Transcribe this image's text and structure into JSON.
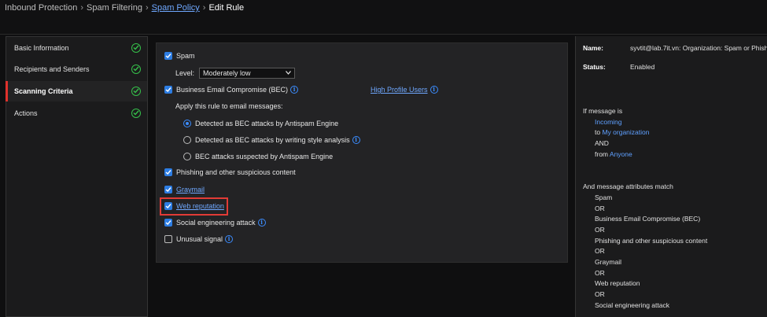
{
  "breadcrumb": {
    "items": [
      "Inbound Protection",
      "Spam Filtering",
      "Spam Policy",
      "Edit Rule"
    ],
    "sep": "›"
  },
  "leftnav": {
    "items": [
      {
        "label": "Basic Information"
      },
      {
        "label": "Recipients and Senders"
      },
      {
        "label": "Scanning Criteria"
      },
      {
        "label": "Actions"
      }
    ]
  },
  "main": {
    "spam_label": "Spam",
    "level_label": "Level:",
    "level_value": "Moderately low",
    "bec_label": "Business Email Compromise (BEC)",
    "high_profile_link": "High Profile Users",
    "apply_label": "Apply this rule to email messages:",
    "radio_antispam": "Detected as BEC attacks by Antispam Engine",
    "radio_writing": "Detected as BEC attacks by writing style analysis",
    "radio_suspected": "BEC attacks suspected by Antispam Engine",
    "phishing_label": "Phishing and other suspicious content",
    "graymail_label": "Graymail",
    "web_rep_label": "Web reputation",
    "social_label": "Social engineering attack",
    "unusual_label": "Unusual signal",
    "info_glyph": "i"
  },
  "summary": {
    "name_label": "Name:",
    "name_value": "syvtit@lab.7it.vn: Organization: Spam or Phish",
    "status_label": "Status:",
    "status_value": "Enabled",
    "if_message": "If message is",
    "incoming": "Incoming",
    "to": "to",
    "my_org": "My organization",
    "and": "AND",
    "from": "from",
    "anyone": "Anyone",
    "attr_match": "And message attributes match",
    "attrs": [
      "Spam",
      "OR",
      "Business Email Compromise (BEC)",
      "OR",
      "Phishing and other suspicious content",
      "OR",
      "Graymail",
      "OR",
      "Web reputation",
      "OR",
      "Social engineering attack"
    ]
  },
  "colors": {
    "accent": "#2d7de3",
    "link": "#6fa8ff",
    "success": "#35c04a",
    "highlight": "#e23b36"
  }
}
